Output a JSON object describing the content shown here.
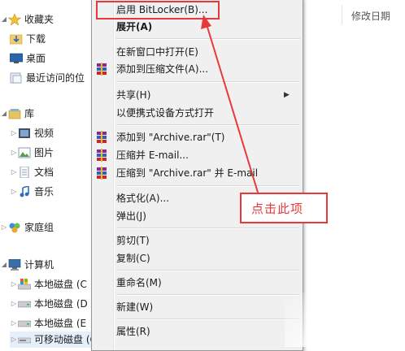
{
  "nav": {
    "favorites": {
      "label": "收藏夹"
    },
    "downloads": {
      "label": "下载"
    },
    "desktop": {
      "label": "桌面"
    },
    "recent": {
      "label": "最近访问的位"
    },
    "library": {
      "label": "库"
    },
    "videos": {
      "label": "视频"
    },
    "pictures": {
      "label": "图片"
    },
    "documents": {
      "label": "文档"
    },
    "music": {
      "label": "音乐"
    },
    "homegroup": {
      "label": "家庭组"
    },
    "computer": {
      "label": "计算机"
    },
    "drive_c": {
      "label": "本地磁盘 (C"
    },
    "drive_d": {
      "label": "本地磁盘 (D"
    },
    "drive_e": {
      "label": "本地磁盘 (E"
    },
    "removable": {
      "label": "可移动磁盘 (G:)"
    }
  },
  "list": {
    "date_header": "修改日期"
  },
  "menu": {
    "bitlocker": "启用 BitLocker(B)...",
    "expand": "展开(A)",
    "open_new_window": "在新窗口中打开(E)",
    "add_to_archive": "添加到压缩文件(A)...",
    "share": "共享(H)",
    "open_portable": "以便携式设备方式打开",
    "add_to_rar": "添加到 \"Archive.rar\"(T)",
    "compress_email": "压缩并 E-mail...",
    "compress_rar_email": "压缩到 \"Archive.rar\" 并 E-mail",
    "format": "格式化(A)...",
    "eject": "弹出(J)",
    "cut": "剪切(T)",
    "copy": "复制(C)",
    "rename": "重命名(M)",
    "new": "新建(W)",
    "properties": "属性(R)"
  },
  "annotation": {
    "callout": "点击此项",
    "color": "#e8393a"
  }
}
